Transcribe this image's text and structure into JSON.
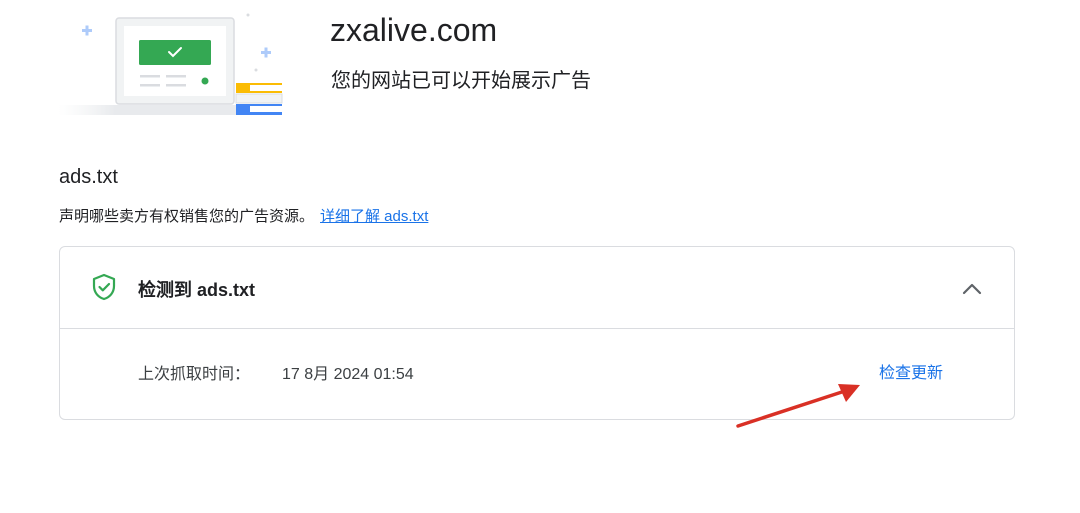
{
  "header": {
    "site_name": "zxalive.com",
    "status_text": "您的网站已可以开始展示广告"
  },
  "ads_section": {
    "title": "ads.txt",
    "description": "声明哪些卖方有权销售您的广告资源。",
    "learn_more_link": "详细了解 ads.txt"
  },
  "card": {
    "title": "检测到 ads.txt",
    "last_crawled_label": "上次抓取时间：",
    "last_crawled_value": "17 8月 2024 01:54",
    "check_update_label": "检查更新",
    "icons": {
      "status": "shield-check-icon",
      "toggle": "chevron-up-icon"
    }
  },
  "colors": {
    "accent_blue": "#1a73e8",
    "success_green": "#34a853",
    "annotation_red": "#d93025"
  }
}
